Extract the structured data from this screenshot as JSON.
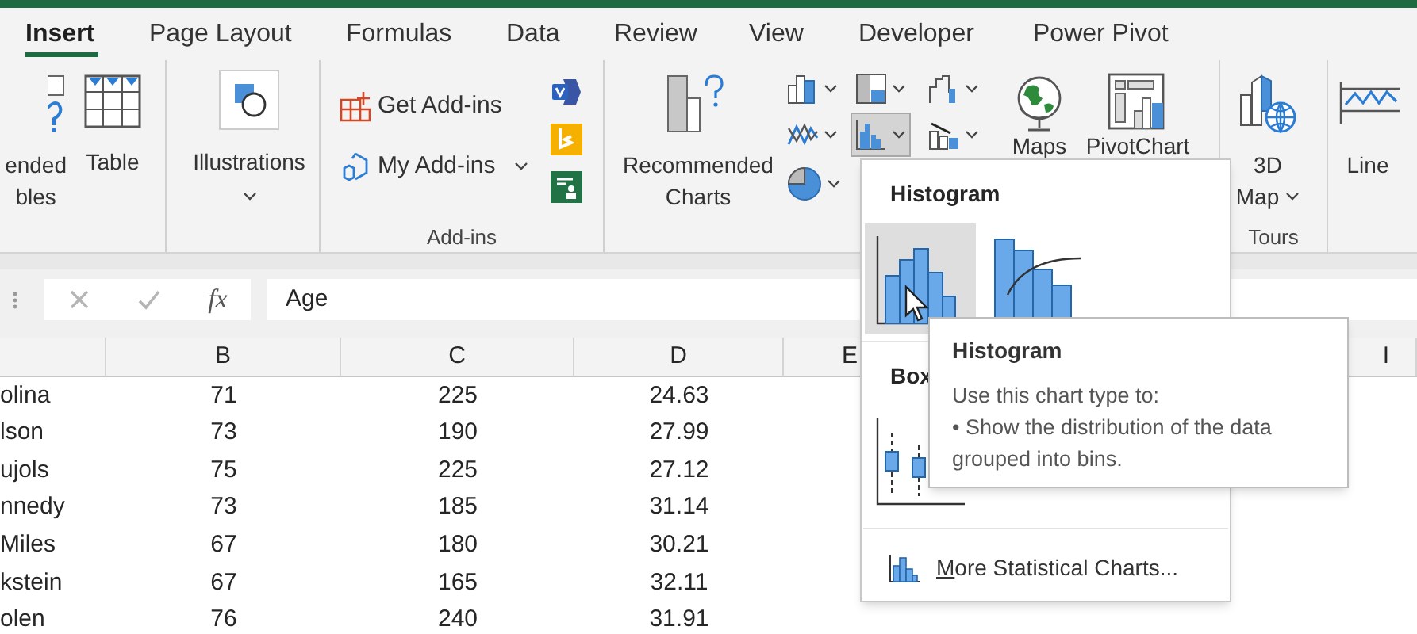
{
  "tabs": [
    {
      "label": "Insert",
      "selected": true
    },
    {
      "label": "Page Layout",
      "selected": false
    },
    {
      "label": "Formulas",
      "selected": false
    },
    {
      "label": "Data",
      "selected": false
    },
    {
      "label": "Review",
      "selected": false
    },
    {
      "label": "View",
      "selected": false
    },
    {
      "label": "Developer",
      "selected": false
    },
    {
      "label": "Power Pivot",
      "selected": false
    }
  ],
  "ribbon": {
    "tables": [
      {
        "kind": "pivot",
        "lines": [
          "ended",
          "bles"
        ]
      },
      {
        "kind": "table",
        "lines": [
          "Table"
        ]
      }
    ],
    "illustrations": {
      "label": "Illustrations"
    },
    "addins": {
      "items": [
        {
          "label": "Get Add-ins"
        },
        {
          "label": "My Add-ins"
        }
      ],
      "group_label": "Add-ins"
    },
    "charts": {
      "recommended": [
        "Recommended",
        "Charts"
      ],
      "chart_types": [
        {
          "kind": "column",
          "selected": false
        },
        {
          "kind": "hierarchy",
          "selected": false
        },
        {
          "kind": "waterfall",
          "selected": false
        },
        {
          "kind": "line",
          "selected": false
        },
        {
          "kind": "statistic",
          "selected": true
        },
        {
          "kind": "combo",
          "selected": false
        },
        {
          "kind": "pie",
          "selected": false
        }
      ],
      "maps": "Maps",
      "pivotchart": "PivotChart"
    },
    "tours": {
      "lines": [
        "3D",
        "Map"
      ],
      "group_label": "Tours"
    },
    "line": "Line"
  },
  "formula_bar": {
    "fx_label": "fx",
    "value": "Age"
  },
  "sheet": {
    "columns": [
      "",
      "B",
      "C",
      "D",
      "E",
      "I"
    ],
    "rows": [
      [
        "olina",
        "71",
        "225",
        "24.63"
      ],
      [
        "lson",
        "73",
        "190",
        "27.99"
      ],
      [
        "ujols",
        "75",
        "225",
        "27.12"
      ],
      [
        "nnedy",
        "73",
        "185",
        "31.14"
      ],
      [
        "Miles",
        "67",
        "180",
        "30.21"
      ],
      [
        "kstein",
        "67",
        "165",
        "32.11"
      ],
      [
        "olen",
        "76",
        "240",
        "31.91"
      ]
    ]
  },
  "dropdown": {
    "sections": [
      {
        "heading": "Histogram",
        "items": [
          {
            "kind": "histogram",
            "selected": true
          },
          {
            "kind": "pareto",
            "selected": false
          }
        ]
      },
      {
        "heading": "Box",
        "items": [
          {
            "kind": "box_whisker",
            "selected": false
          }
        ]
      }
    ],
    "more": "More Statistical Charts..."
  },
  "tooltip": {
    "title": "Histogram",
    "intro": "Use this chart type to:",
    "bullet": "• Show the distribution of the data grouped into bins."
  }
}
